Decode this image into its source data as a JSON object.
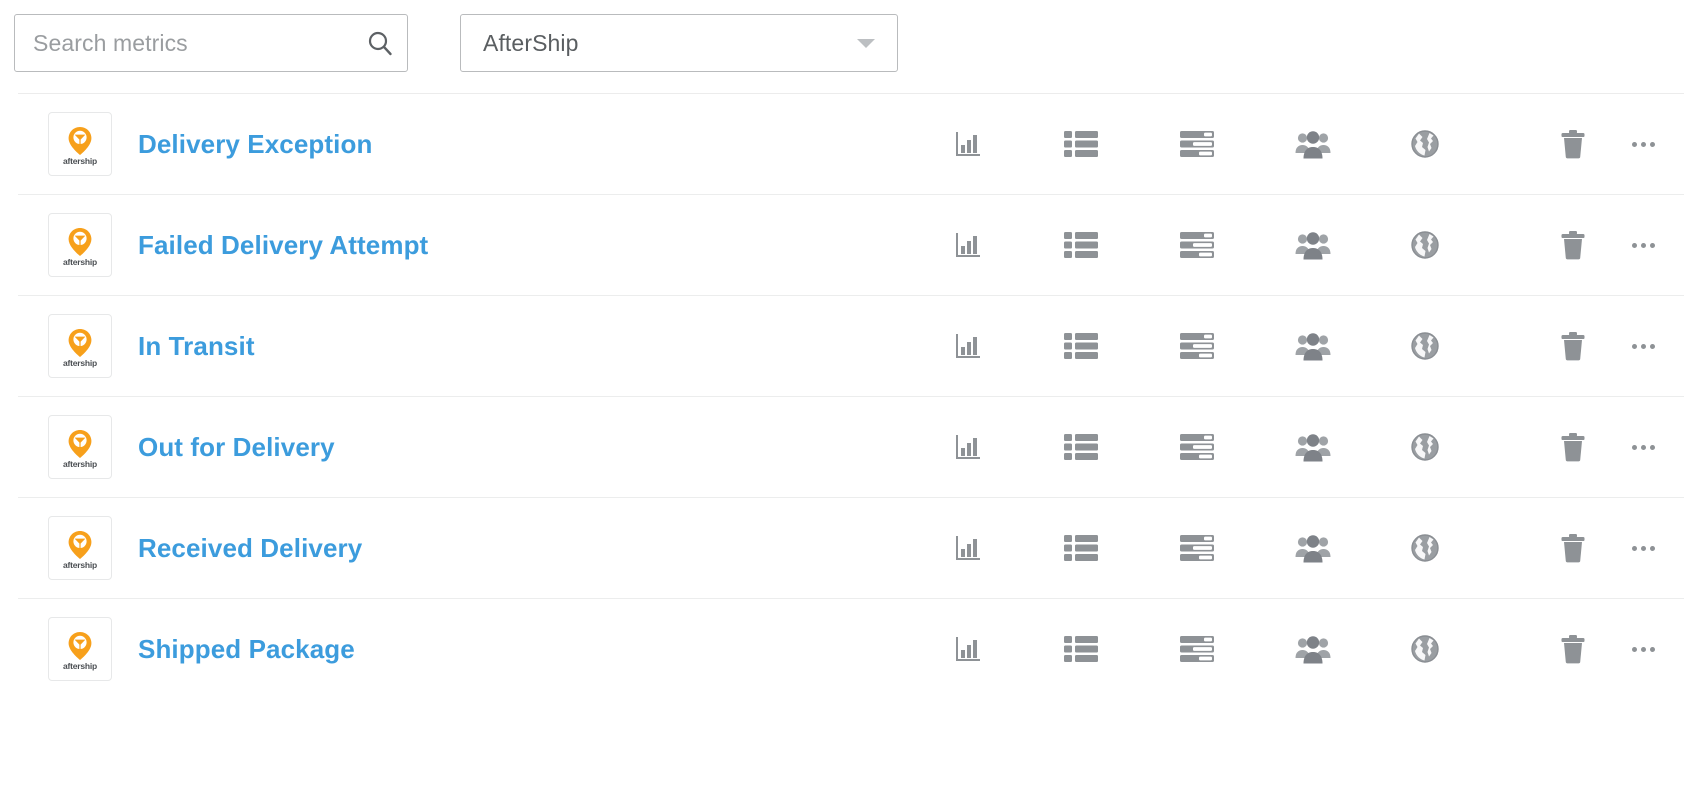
{
  "toolbar": {
    "search": {
      "placeholder": "Search metrics",
      "value": "",
      "icon": "search-icon"
    },
    "app_filter": {
      "selected": "AfterShip",
      "icon": "chevron-down-icon"
    }
  },
  "colors": {
    "link": "#3c9cdd",
    "border": "#b9bbbd",
    "row_divider": "#eceded",
    "icon": "#8e9296",
    "brand_orange": "#f7a01b",
    "placeholder": "#9a9da0"
  },
  "list": {
    "app_logo": {
      "name": "aftership-logo",
      "wordmark": "aftership"
    },
    "action_icons": [
      {
        "name": "bar-chart-icon",
        "title": "Charts"
      },
      {
        "name": "list-icon",
        "title": "List"
      },
      {
        "name": "tasks-icon",
        "title": "Tasks"
      },
      {
        "name": "users-icon",
        "title": "People"
      },
      {
        "name": "globe-icon",
        "title": "Global"
      },
      {
        "name": "trash-icon",
        "title": "Delete"
      },
      {
        "name": "more-icon",
        "title": "More"
      }
    ],
    "rows": [
      {
        "name": "Delivery Exception"
      },
      {
        "name": "Failed Delivery Attempt"
      },
      {
        "name": "In Transit"
      },
      {
        "name": "Out for Delivery"
      },
      {
        "name": "Received Delivery"
      },
      {
        "name": "Shipped Package"
      }
    ]
  }
}
